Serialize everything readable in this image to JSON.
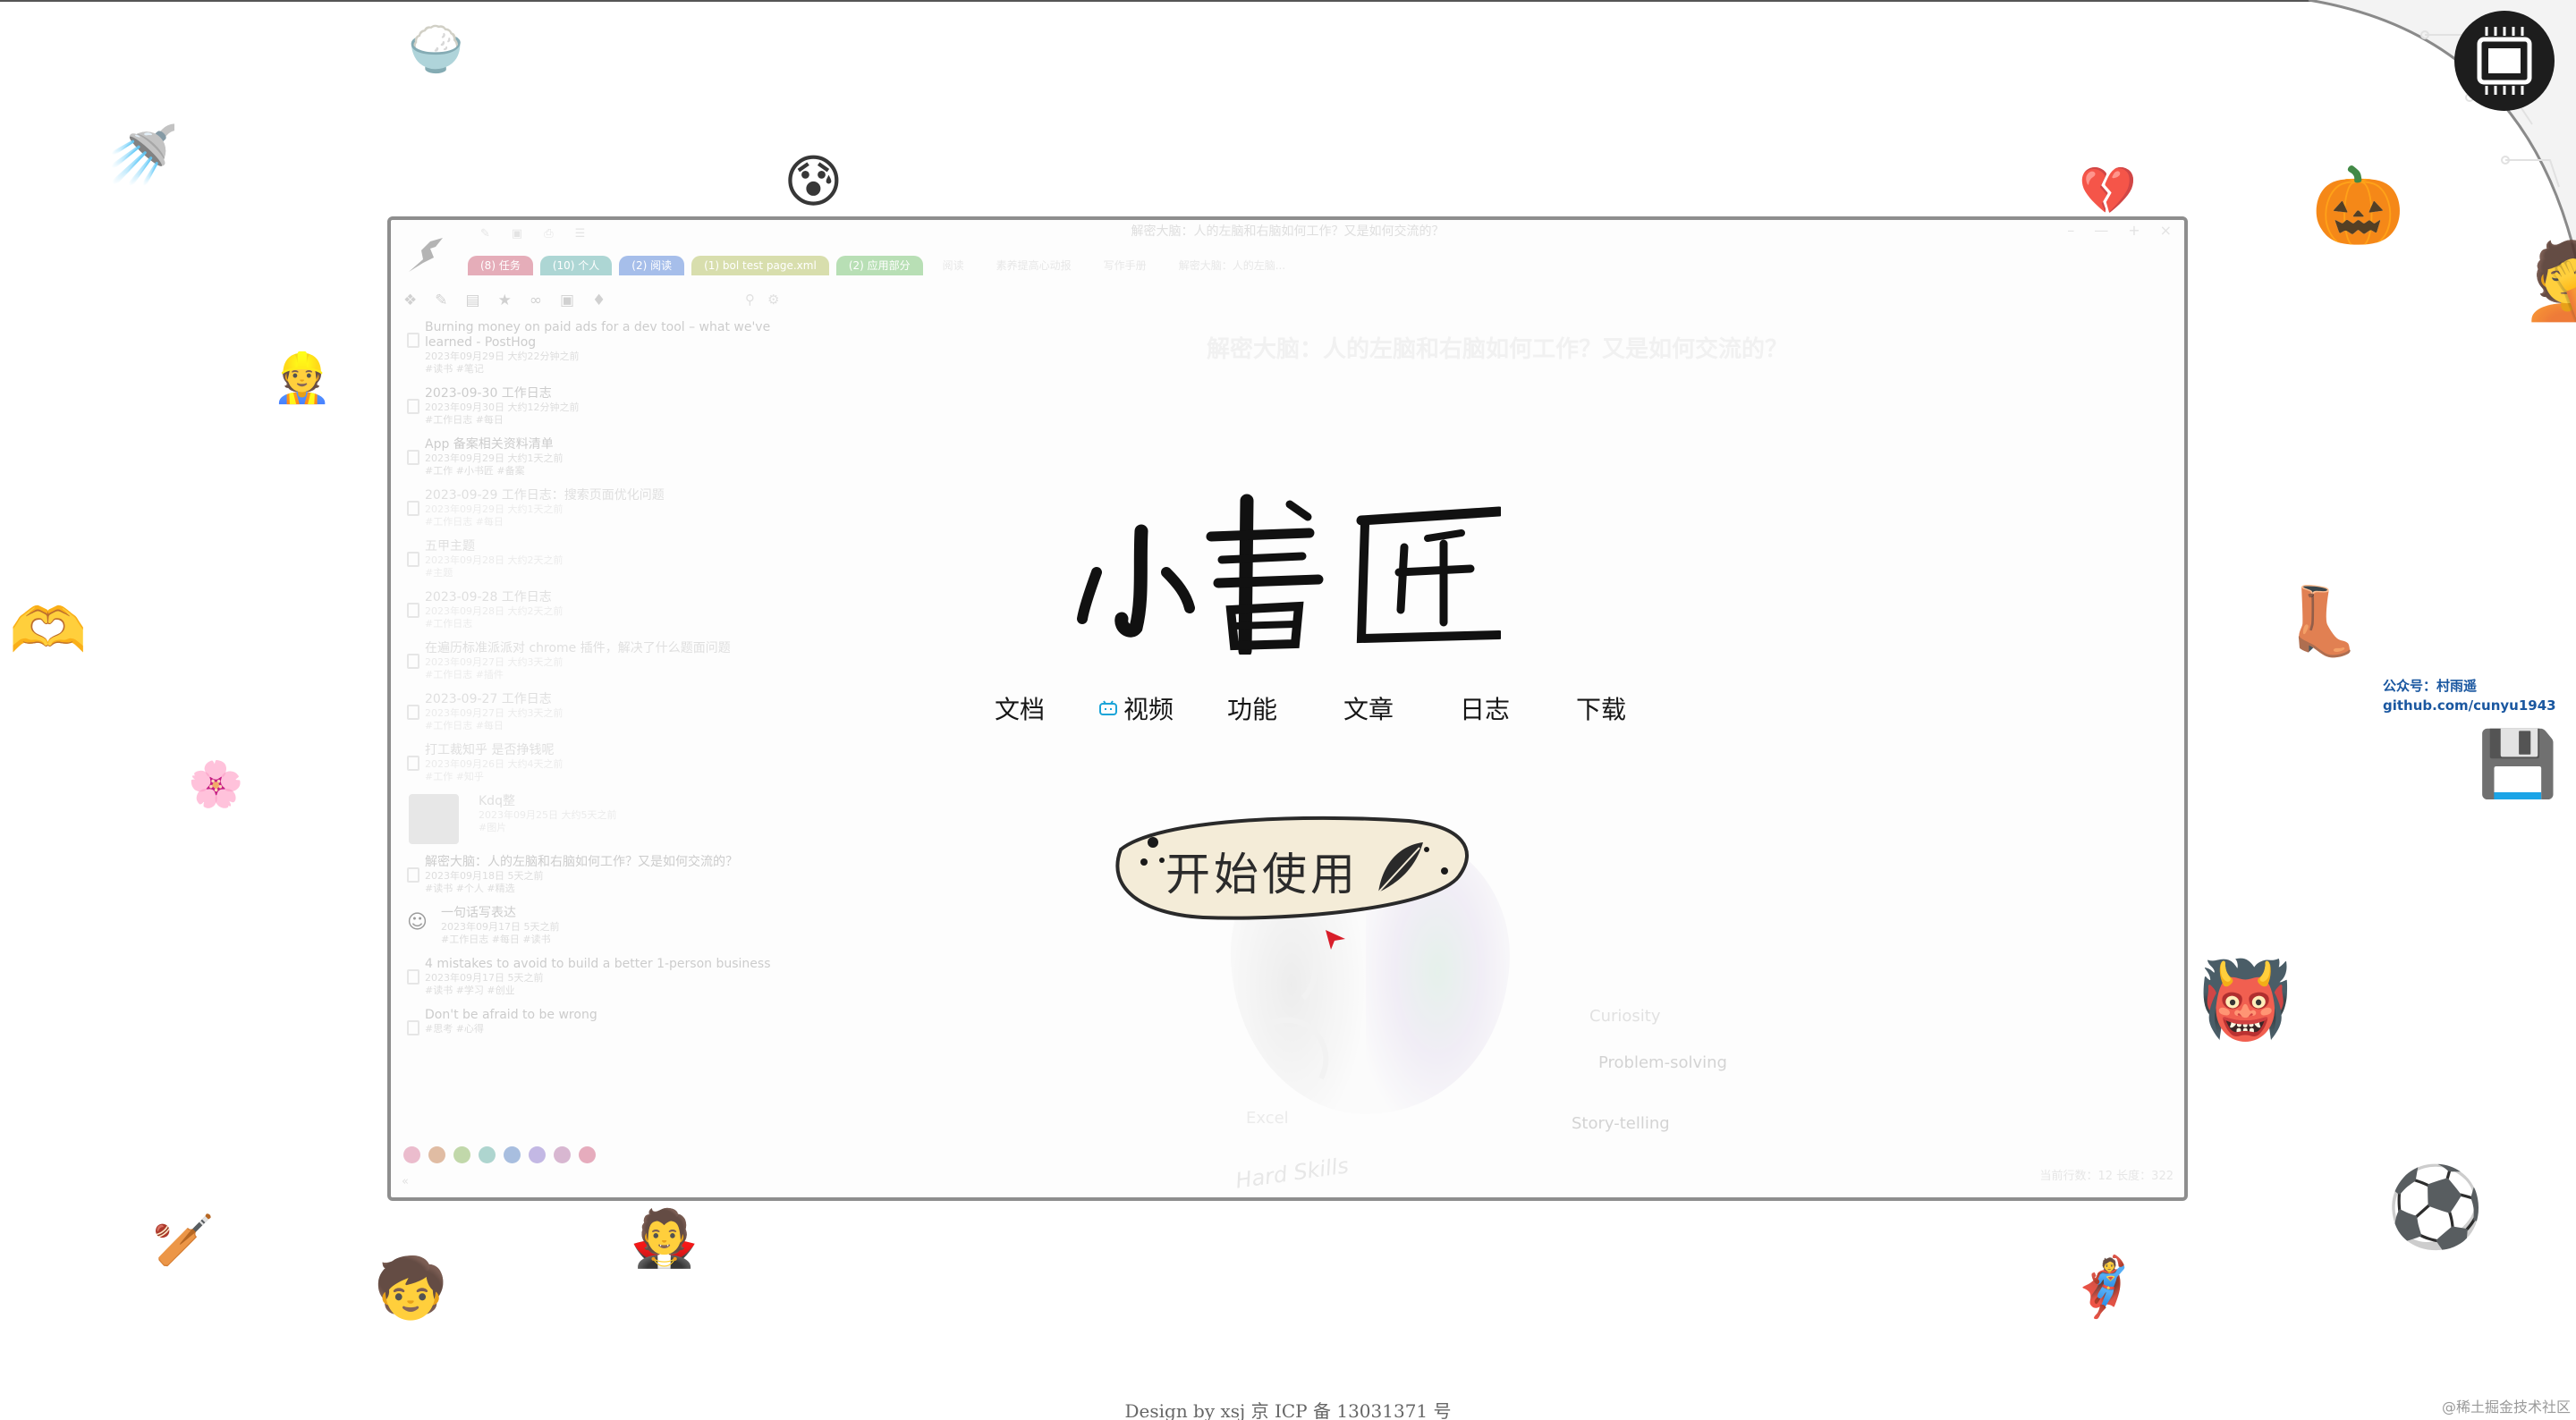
{
  "app_window": {
    "title": "解密大脑：人的左脑和右脑如何工作？又是如何交流的？",
    "tabs": [
      {
        "label": "(8) 任务",
        "color": "#c64a64"
      },
      {
        "label": "(10) 个人",
        "color": "#4aa5a0"
      },
      {
        "label": "(2) 阅读",
        "color": "#3b6fd1"
      },
      {
        "label": "(1) bol test page.xml",
        "color": "#a8b74a"
      },
      {
        "label": "(2) 应用部分",
        "color": "#62b85c"
      },
      {
        "label": "阅读",
        "color": ""
      },
      {
        "label": "素养提高心动报",
        "color": ""
      },
      {
        "label": "写作手册",
        "color": ""
      },
      {
        "label": "解密大脑：人的左脑...",
        "color": ""
      }
    ],
    "docs": [
      {
        "title": "Burning money on paid ads for a dev tool – what we've learned - PostHog",
        "meta1": "2023年09月29日 大约22分钟之前",
        "meta2": "#读书 #笔记"
      },
      {
        "title": "2023-09-30 工作日志",
        "meta1": "2023年09月30日 大约12分钟之前",
        "meta2": "#工作日志 #每日"
      },
      {
        "title": "App 备案相关资料清单",
        "meta1": "2023年09月29日 大约1天之前",
        "meta2": "#工作 #小书匠 #备案"
      },
      {
        "title": "2023-09-29 工作日志：搜索页面优化问题",
        "meta1": "2023年09月29日 大约1天之前",
        "meta2": "#工作日志 #每日"
      },
      {
        "title": "五甲主题",
        "meta1": "2023年09月28日 大约2天之前",
        "meta2": "#主题"
      },
      {
        "title": "2023-09-28 工作日志",
        "meta1": "2023年09月28日 大约2天之前",
        "meta2": "#工作日志"
      },
      {
        "title": "在遍历标准派派对 chrome 插件，解决了什么题面问题",
        "meta1": "2023年09月27日 大约3天之前",
        "meta2": "#工作日志 #插件"
      },
      {
        "title": "2023-09-27 工作日志",
        "meta1": "2023年09月27日 大约3天之前",
        "meta2": "#工作日志 #每日"
      },
      {
        "title": "打工裁知乎 是否挣钱呢",
        "meta1": "2023年09月26日 大约4天之前",
        "meta2": "#工作 #知乎"
      },
      {
        "title": "Kdq整",
        "meta1": "2023年09月25日 大约5天之前",
        "meta2": "#图片"
      },
      {
        "title": "解密大脑：人的左脑和右脑如何工作？又是如何交流的？",
        "meta1": "2023年09月18日 5天之前",
        "meta2": "#读书 #个人 #精选"
      },
      {
        "title": "一句话写表达",
        "meta1": "2023年09月17日 5天之前",
        "meta2": "#工作日志 #每日 #读书"
      },
      {
        "title": "4 mistakes to avoid to build a better 1-person business",
        "meta1": "2023年09月17日 5天之前",
        "meta2": "#读书 #学习 #创业"
      },
      {
        "title": "Don't be afraid to be wrong",
        "meta1": "",
        "meta2": "#思考 #心得"
      }
    ],
    "color_dots": [
      "#d26b91",
      "#bb6a34",
      "#77a843",
      "#4da395",
      "#3e6fb8",
      "#7a63c4",
      "#a85f9a",
      "#c7476d"
    ],
    "stats": "当前行数：12  长度：322",
    "skills": [
      "Curiosity",
      "Problem-solving",
      "Story-telling",
      "Excel",
      "Hard Skills"
    ]
  },
  "brand": {
    "name": "小书匠"
  },
  "nav": [
    {
      "label": "文档",
      "icon": ""
    },
    {
      "label": "视频",
      "icon": "bilibili-icon"
    },
    {
      "label": "功能",
      "icon": ""
    },
    {
      "label": "文章",
      "icon": ""
    },
    {
      "label": "日志",
      "icon": ""
    },
    {
      "label": "下载",
      "icon": ""
    }
  ],
  "cta": {
    "label": "开始使用",
    "icon": "feather-icon"
  },
  "contact": {
    "line1": "公众号：村雨遥",
    "line2": "github.com/cunyu1943"
  },
  "footer": {
    "text": "Design by xsj 京 ICP 备 13031371 号"
  },
  "watermark": "@稀土掘金技术社区",
  "emojis": [
    "🍚",
    "🚿",
    "😰",
    "💔",
    "🎃",
    "🤦",
    "👷",
    "🫶",
    "👢",
    "🌸",
    "💾",
    "👹",
    "⚽",
    "🏏",
    "🧛",
    "🧒",
    "🦸",
    "🦬",
    "🧑‍🌾",
    "🔗",
    "📈"
  ]
}
